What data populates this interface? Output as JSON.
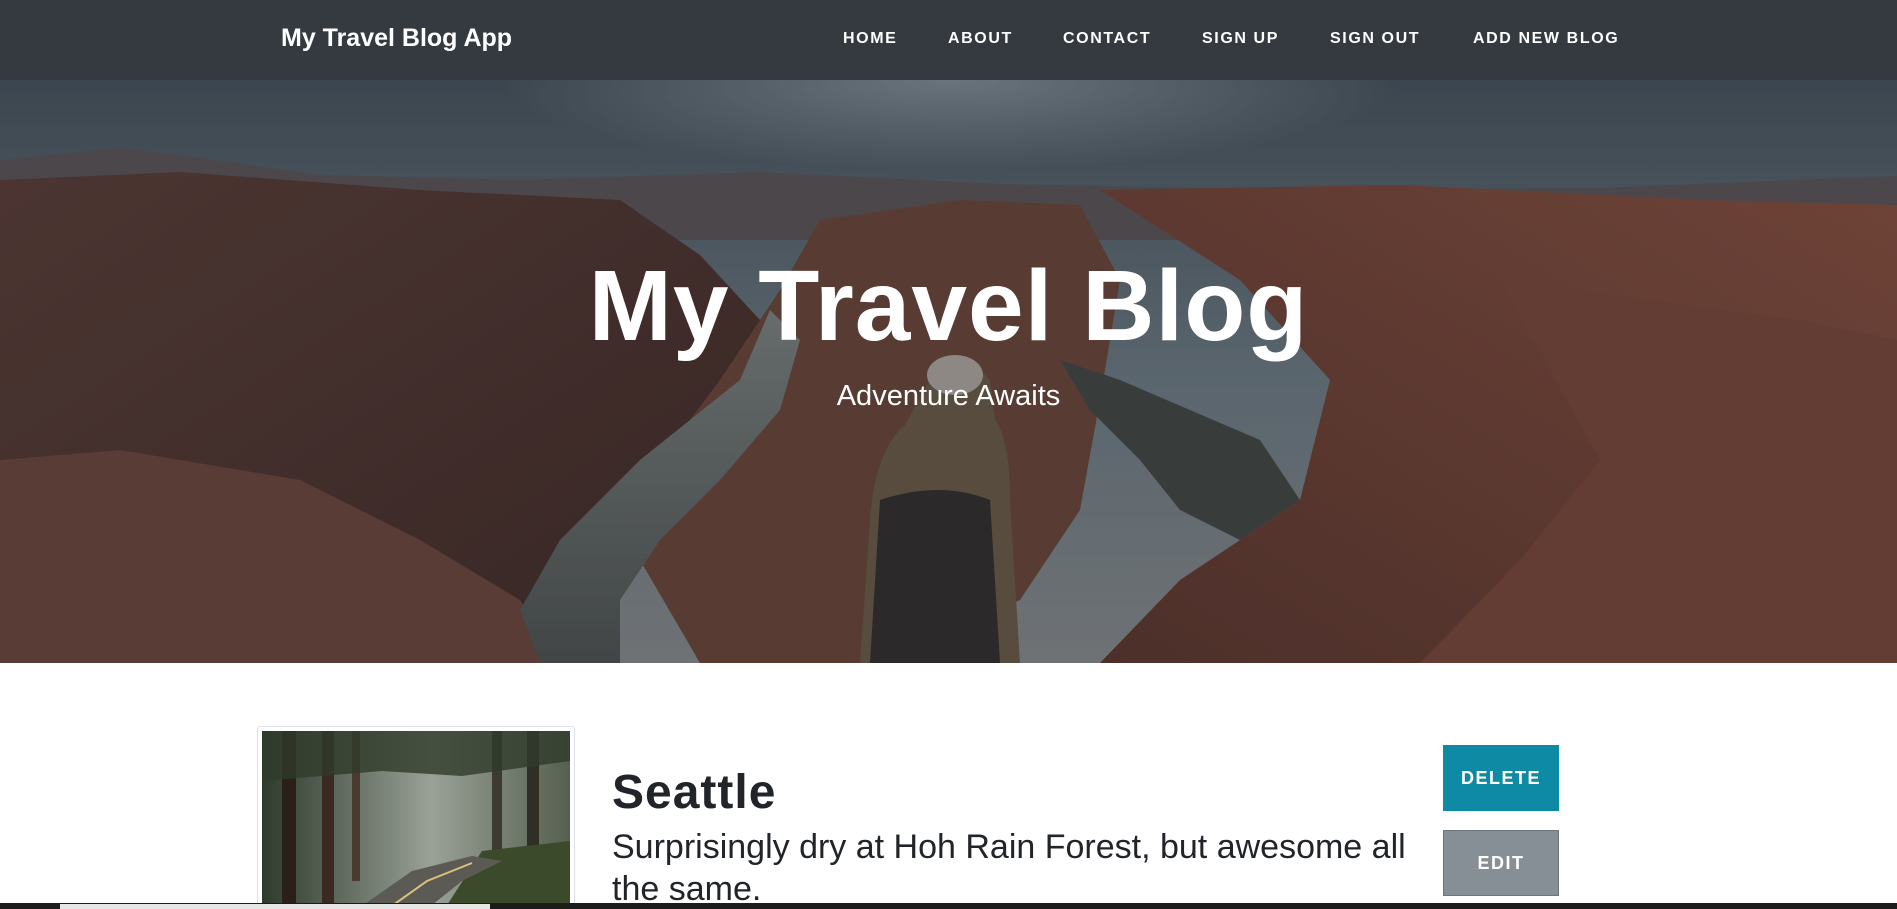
{
  "navbar": {
    "brand": "My Travel Blog App",
    "links": [
      "HOME",
      "ABOUT",
      "CONTACT",
      "SIGN UP",
      "SIGN OUT",
      "ADD NEW BLOG"
    ]
  },
  "hero": {
    "title": "My Travel Blog",
    "subtitle": "Adventure Awaits"
  },
  "post": {
    "title": "Seattle",
    "excerpt": "Surprisingly dry at Hoh Rain Forest, but awesome all the same.",
    "delete_label": "DELETE",
    "edit_label": "EDIT"
  },
  "colors": {
    "navbar_bg": "#343a40",
    "delete_button": "#0f8aa5",
    "edit_button": "#868e96"
  }
}
